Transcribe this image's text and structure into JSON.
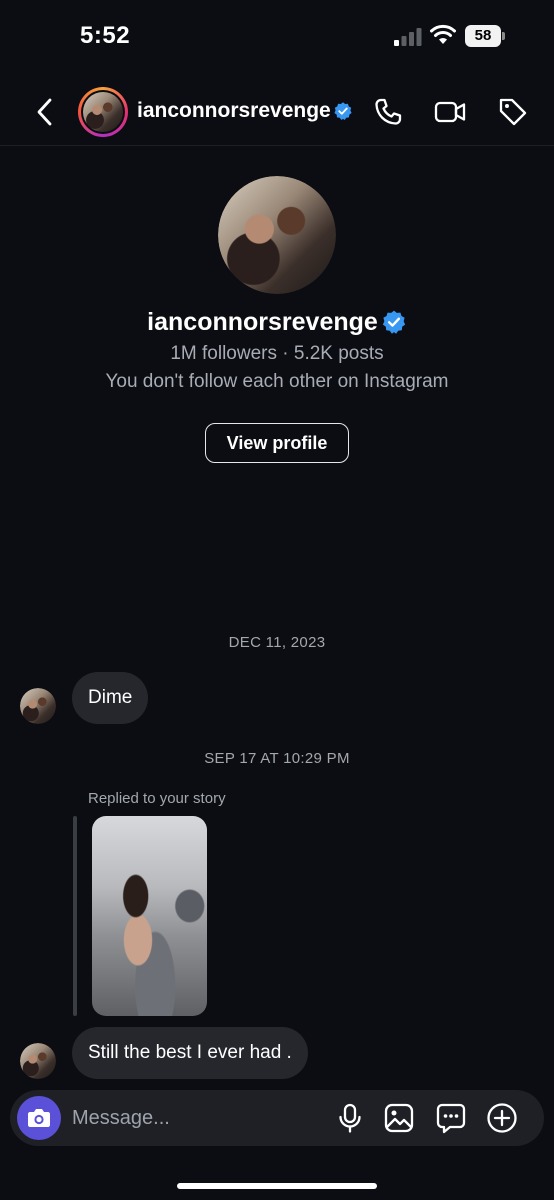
{
  "status_bar": {
    "time": "5:52",
    "battery": "58"
  },
  "header": {
    "username": "ianconnorsrevenge",
    "icons": [
      "chevron-left-icon",
      "phone-icon",
      "video-icon",
      "tag-icon"
    ]
  },
  "profile": {
    "username": "ianconnorsrevenge",
    "stats": "1M followers · 5.2K posts",
    "note": "You don't follow each other on Instagram",
    "view_profile_label": "View profile"
  },
  "messages": [
    {
      "timestamp": "DEC 11, 2023",
      "text": "Dime"
    },
    {
      "timestamp": "SEP 17 AT 10:29 PM",
      "reply_label": "Replied to your story",
      "text": "Still the best I ever had ."
    }
  ],
  "composer": {
    "placeholder": "Message...",
    "icons": [
      "camera-icon",
      "microphone-icon",
      "gallery-icon",
      "sticker-icon",
      "plus-icon"
    ]
  },
  "colors": {
    "accent": "#5b51d8",
    "verified": "#3897f0",
    "background": "#0b0d12",
    "bubble": "#25272d"
  }
}
